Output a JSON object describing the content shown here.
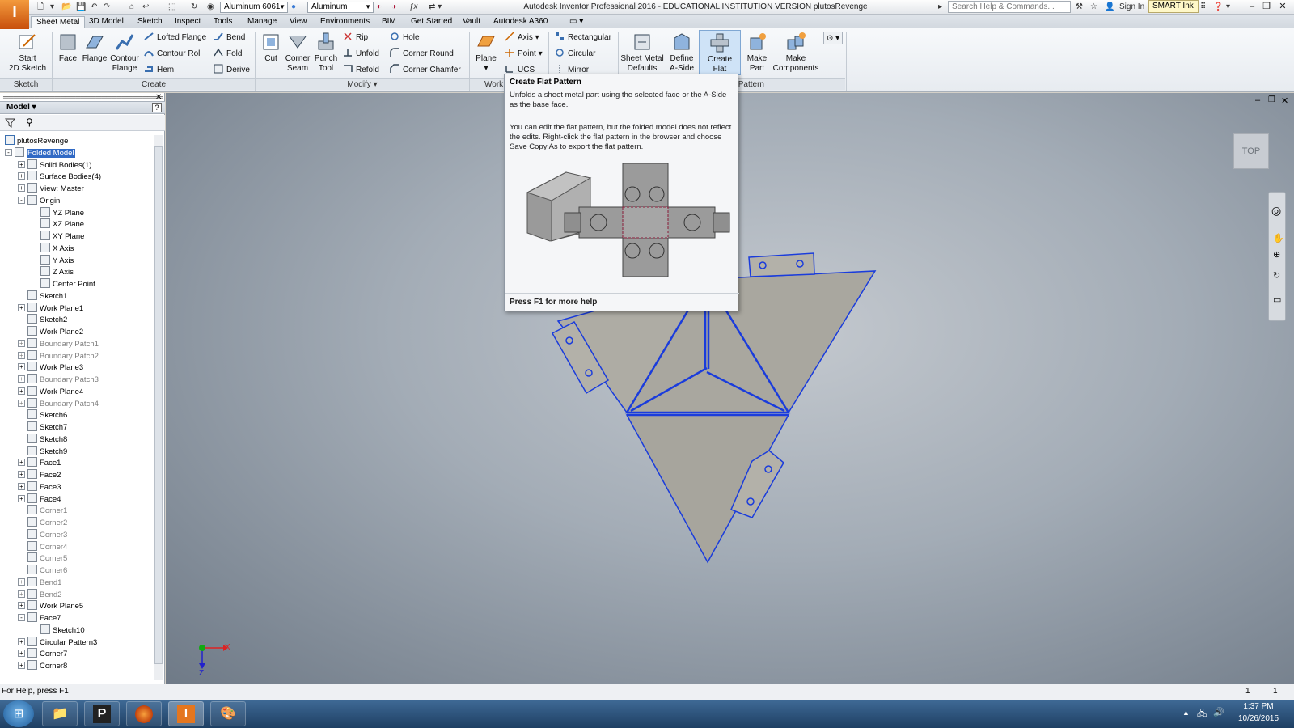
{
  "app": {
    "logo_letter": "I",
    "logo_sub": "PRO",
    "window_title": "Autodesk Inventor Professional 2016 - EDUCATIONAL INSTITUTION VERSION   plutosRevenge",
    "material_combo": "Aluminum 6061",
    "appearance_combo": "Aluminum",
    "search_placeholder": "Search Help & Commands...",
    "sign_in": "Sign In",
    "smart_ink": "SMART Ink"
  },
  "tabs": [
    "Sheet Metal",
    "3D Model",
    "Sketch",
    "Inspect",
    "Tools",
    "Manage",
    "View",
    "Environments",
    "BIM",
    "Get Started",
    "Vault",
    "Autodesk A360"
  ],
  "ribbon": {
    "sketch": {
      "start_label": "Start",
      "start_label2": "2D Sketch",
      "panel": "Sketch"
    },
    "create": {
      "face": "Face",
      "flange": "Flange",
      "contour": "Contour",
      "contour2": "Flange",
      "lofted_flange": "Lofted Flange",
      "contour_roll": "Contour Roll",
      "hem": "Hem",
      "bend": "Bend",
      "fold": "Fold",
      "derive": "Derive",
      "panel": "Create"
    },
    "modify": {
      "cut": "Cut",
      "corner": "Corner",
      "seam": "Seam",
      "punch": "Punch",
      "tool": "Tool",
      "rip": "Rip",
      "unfold": "Unfold",
      "refold": "Refold",
      "hole": "Hole",
      "corner_round": "Corner Round",
      "corner_chamfer": "Corner Chamfer",
      "panel": "Modify"
    },
    "work": {
      "plane": "Plane",
      "axis": "Axis",
      "point": "Point",
      "ucs": "UCS",
      "panel": "Work"
    },
    "pattern": {
      "rectangular": "Rectangular",
      "circular": "Circular",
      "mirror": "Mirror",
      "sm_defaults": "Sheet Metal",
      "sm_defaults2": "Defaults",
      "define": "Define",
      "define2": "A-Side",
      "create_flat": "Create",
      "create_flat2": "Flat Pattern",
      "make_part": "Make",
      "make_part2": "Part",
      "make_comp": "Make",
      "make_comp2": "Components",
      "panel": "Pattern"
    }
  },
  "browser": {
    "title": "Model",
    "root": "plutosRevenge",
    "items": [
      {
        "label": "Folded Model",
        "indent": 1,
        "exp": "-",
        "selected": true
      },
      {
        "label": "Solid Bodies(1)",
        "indent": 2,
        "exp": "+"
      },
      {
        "label": "Surface Bodies(4)",
        "indent": 2,
        "exp": "+"
      },
      {
        "label": "View: Master",
        "indent": 2,
        "exp": "+"
      },
      {
        "label": "Origin",
        "indent": 2,
        "exp": "-"
      },
      {
        "label": "YZ Plane",
        "indent": 3
      },
      {
        "label": "XZ Plane",
        "indent": 3
      },
      {
        "label": "XY Plane",
        "indent": 3
      },
      {
        "label": "X Axis",
        "indent": 3
      },
      {
        "label": "Y Axis",
        "indent": 3
      },
      {
        "label": "Z Axis",
        "indent": 3
      },
      {
        "label": "Center Point",
        "indent": 3
      },
      {
        "label": "Sketch1",
        "indent": 2
      },
      {
        "label": "Work Plane1",
        "indent": 2,
        "exp": "+"
      },
      {
        "label": "Sketch2",
        "indent": 2
      },
      {
        "label": "Work Plane2",
        "indent": 2
      },
      {
        "label": "Boundary Patch1",
        "indent": 2,
        "exp": "+",
        "dim": true
      },
      {
        "label": "Boundary Patch2",
        "indent": 2,
        "exp": "+",
        "dim": true
      },
      {
        "label": "Work Plane3",
        "indent": 2,
        "exp": "+"
      },
      {
        "label": "Boundary Patch3",
        "indent": 2,
        "exp": "+",
        "dim": true
      },
      {
        "label": "Work Plane4",
        "indent": 2,
        "exp": "+"
      },
      {
        "label": "Boundary Patch4",
        "indent": 2,
        "exp": "+",
        "dim": true
      },
      {
        "label": "Sketch6",
        "indent": 2
      },
      {
        "label": "Sketch7",
        "indent": 2
      },
      {
        "label": "Sketch8",
        "indent": 2
      },
      {
        "label": "Sketch9",
        "indent": 2
      },
      {
        "label": "Face1",
        "indent": 2,
        "exp": "+"
      },
      {
        "label": "Face2",
        "indent": 2,
        "exp": "+"
      },
      {
        "label": "Face3",
        "indent": 2,
        "exp": "+"
      },
      {
        "label": "Face4",
        "indent": 2,
        "exp": "+"
      },
      {
        "label": "Corner1",
        "indent": 2,
        "dim": true
      },
      {
        "label": "Corner2",
        "indent": 2,
        "dim": true
      },
      {
        "label": "Corner3",
        "indent": 2,
        "dim": true
      },
      {
        "label": "Corner4",
        "indent": 2,
        "dim": true
      },
      {
        "label": "Corner5",
        "indent": 2,
        "dim": true
      },
      {
        "label": "Corner6",
        "indent": 2,
        "dim": true
      },
      {
        "label": "Bend1",
        "indent": 2,
        "exp": "+",
        "dim": true
      },
      {
        "label": "Bend2",
        "indent": 2,
        "exp": "+",
        "dim": true
      },
      {
        "label": "Work Plane5",
        "indent": 2,
        "exp": "+"
      },
      {
        "label": "Face7",
        "indent": 2,
        "exp": "-"
      },
      {
        "label": "Sketch10",
        "indent": 3
      },
      {
        "label": "Circular Pattern3",
        "indent": 2,
        "exp": "+"
      },
      {
        "label": "Corner7",
        "indent": 2,
        "exp": "+"
      },
      {
        "label": "Corner8",
        "indent": 2,
        "exp": "+"
      }
    ]
  },
  "viewport": {
    "viewcube": "TOP",
    "axis_x": "X",
    "axis_z": "Z"
  },
  "tooltip": {
    "title": "Create Flat Pattern",
    "desc1": "Unfolds a sheet metal part using the selected face or the A-Side as the base face.",
    "desc2": "You can edit the flat pattern, but the folded model does not reflect the edits. Right-click the flat pattern in the browser and choose Save Copy As to export the flat pattern.",
    "footer": "Press F1 for more help"
  },
  "status": {
    "help_text": "For Help, press F1",
    "count1": "1",
    "count2": "1"
  },
  "taskbar": {
    "time": "1:37 PM",
    "date": "10/26/2015"
  }
}
